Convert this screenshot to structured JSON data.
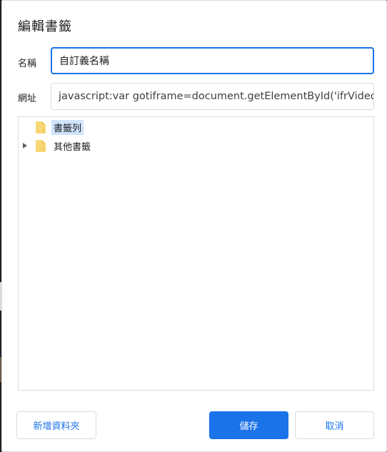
{
  "dialog": {
    "title": "編輯書籤",
    "name_label": "名稱",
    "name_value": "自訂義名稱",
    "url_label": "網址",
    "url_value": "javascript:var gotiframe=document.getElementById('ifrVideo');va"
  },
  "tree": {
    "items": [
      {
        "label": "書籤列",
        "selected": true,
        "expandable": false,
        "icon": "folder-icon"
      },
      {
        "label": "其他書籤",
        "selected": false,
        "expandable": true,
        "icon": "folder-icon"
      }
    ]
  },
  "buttons": {
    "new_folder": "新增資料夾",
    "save": "儲存",
    "cancel": "取消"
  },
  "colors": {
    "accent": "#1a73e8",
    "selection": "#cfe3fb",
    "folder": "#f8d775"
  }
}
